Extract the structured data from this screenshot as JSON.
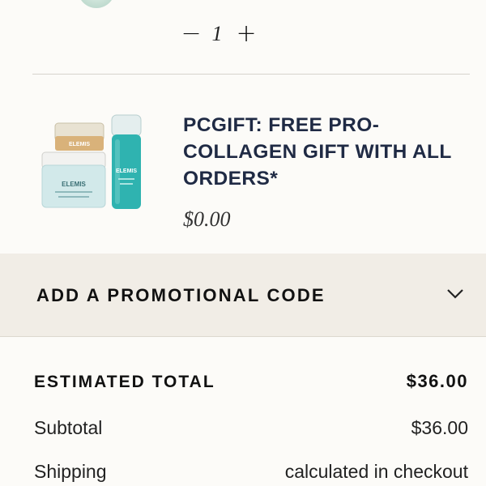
{
  "cart_item": {
    "quantity": "1",
    "decrement_symbol": "−",
    "increment_symbol": "+"
  },
  "gift_item": {
    "title": "PCGIFT: FREE PRO-COLLAGEN GIFT WITH ALL ORDERS*",
    "price": "$0.00",
    "image_brand_text": "ELEMIS"
  },
  "promo": {
    "label": "ADD A PROMOTIONAL CODE",
    "icon": "chevron-down-icon"
  },
  "totals": {
    "estimated_total_label": "ESTIMATED TOTAL",
    "estimated_total_value": "$36.00",
    "subtotal_label": "Subtotal",
    "subtotal_value": "$36.00",
    "shipping_label": "Shipping",
    "shipping_value": "calculated in checkout"
  },
  "colors": {
    "background": "#fcfbf8",
    "promo_band": "#f1ede6",
    "title_navy": "#1f2a44",
    "divider": "#d6d3cc"
  }
}
